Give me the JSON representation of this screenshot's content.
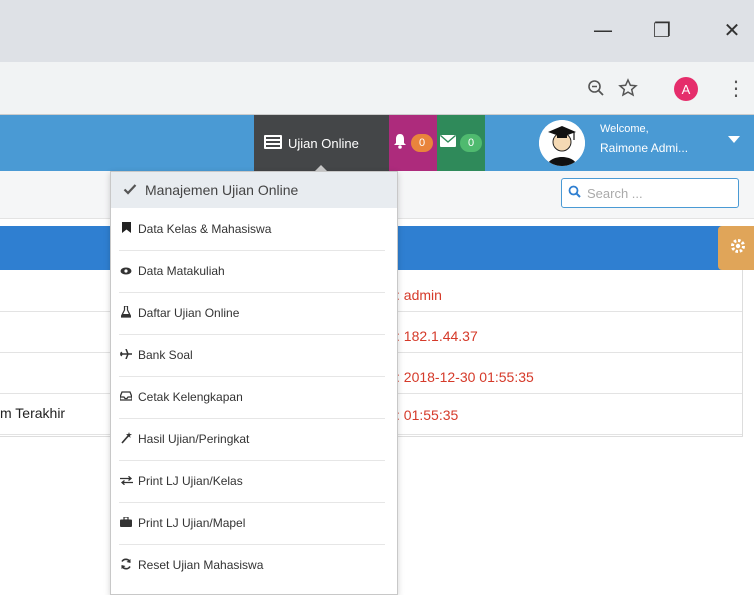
{
  "window": {
    "minimize_glyph": "—",
    "restore_glyph": "❐",
    "close_glyph": "✕"
  },
  "addressbar": {
    "zoom_icon": "zoom-icon",
    "star_icon": "bookmark-star-icon",
    "profile_initial": "A",
    "menu_glyph": "⋮"
  },
  "nav": {
    "ujian_label": "Ujian Online",
    "notif_count": "0",
    "mail_count": "0",
    "welcome_line1": "Welcome,",
    "welcome_line2": "Raimone Admi..."
  },
  "search": {
    "placeholder": "Search ..."
  },
  "table": {
    "rows": [
      {
        "label": "",
        "value": ": admin"
      },
      {
        "label": "",
        "value": ": 182.1.44.37"
      },
      {
        "label": "",
        "value": ": 2018-12-30 01:55:35"
      },
      {
        "label": "m Terakhir",
        "value": ": 01:55:35"
      }
    ]
  },
  "dropdown": {
    "header": "Manajemen Ujian Online",
    "items": [
      {
        "label": "Data Kelas & Mahasiswa",
        "icon": "bookmark-icon"
      },
      {
        "label": "Data Matakuliah",
        "icon": "eye-icon"
      },
      {
        "label": "Daftar Ujian Online",
        "icon": "flask-icon"
      },
      {
        "label": "Bank Soal",
        "icon": "plane-icon"
      },
      {
        "label": "Cetak Kelengkapan",
        "icon": "inbox-icon"
      },
      {
        "label": "Hasil Ujian/Peringkat",
        "icon": "magic-icon"
      },
      {
        "label": "Print LJ Ujian/Kelas",
        "icon": "exchange-icon"
      },
      {
        "label": "Print LJ Ujian/Mapel",
        "icon": "briefcase-icon"
      },
      {
        "label": "Reset Ujian Mahasiswa",
        "icon": "refresh-icon"
      }
    ]
  },
  "colors": {
    "nav_blue": "#4a9ad4",
    "panel_blue": "#2f7fd1",
    "value_red": "#d53a2a",
    "ujian_bg": "#444648",
    "bell_bg": "#ad2b7c",
    "mail_bg": "#2f8a5a"
  }
}
